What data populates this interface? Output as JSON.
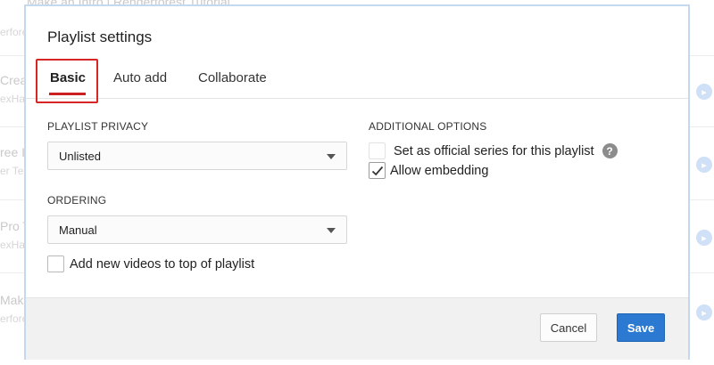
{
  "background": {
    "top_text": "Make an Intro | Renderforest Tutorial",
    "items": [
      {
        "title": "Creat",
        "sub": "exHa"
      },
      {
        "title": "ree I",
        "sub": "er Te"
      },
      {
        "title": "Pro T",
        "sub": "exHa"
      },
      {
        "title": "Make",
        "sub": "erfore"
      }
    ],
    "first_sub": "erfore"
  },
  "dialog": {
    "title": "Playlist settings",
    "tabs": [
      {
        "label": "Basic",
        "active": true
      },
      {
        "label": "Auto add",
        "active": false
      },
      {
        "label": "Collaborate",
        "active": false
      }
    ],
    "privacy": {
      "label": "PLAYLIST PRIVACY",
      "selected": "Unlisted"
    },
    "ordering": {
      "label": "ORDERING",
      "selected": "Manual"
    },
    "add_to_top": {
      "label": "Add new videos to top of playlist",
      "checked": false
    },
    "additional": {
      "label": "ADDITIONAL OPTIONS",
      "official_series": {
        "label": "Set as official series for this playlist",
        "checked": false,
        "help": "?"
      },
      "embedding": {
        "label": "Allow embedding",
        "checked": true
      }
    },
    "buttons": {
      "cancel": "Cancel",
      "save": "Save"
    }
  },
  "colors": {
    "accent_red": "#cc1f1f",
    "save_blue": "#2c79d1"
  }
}
